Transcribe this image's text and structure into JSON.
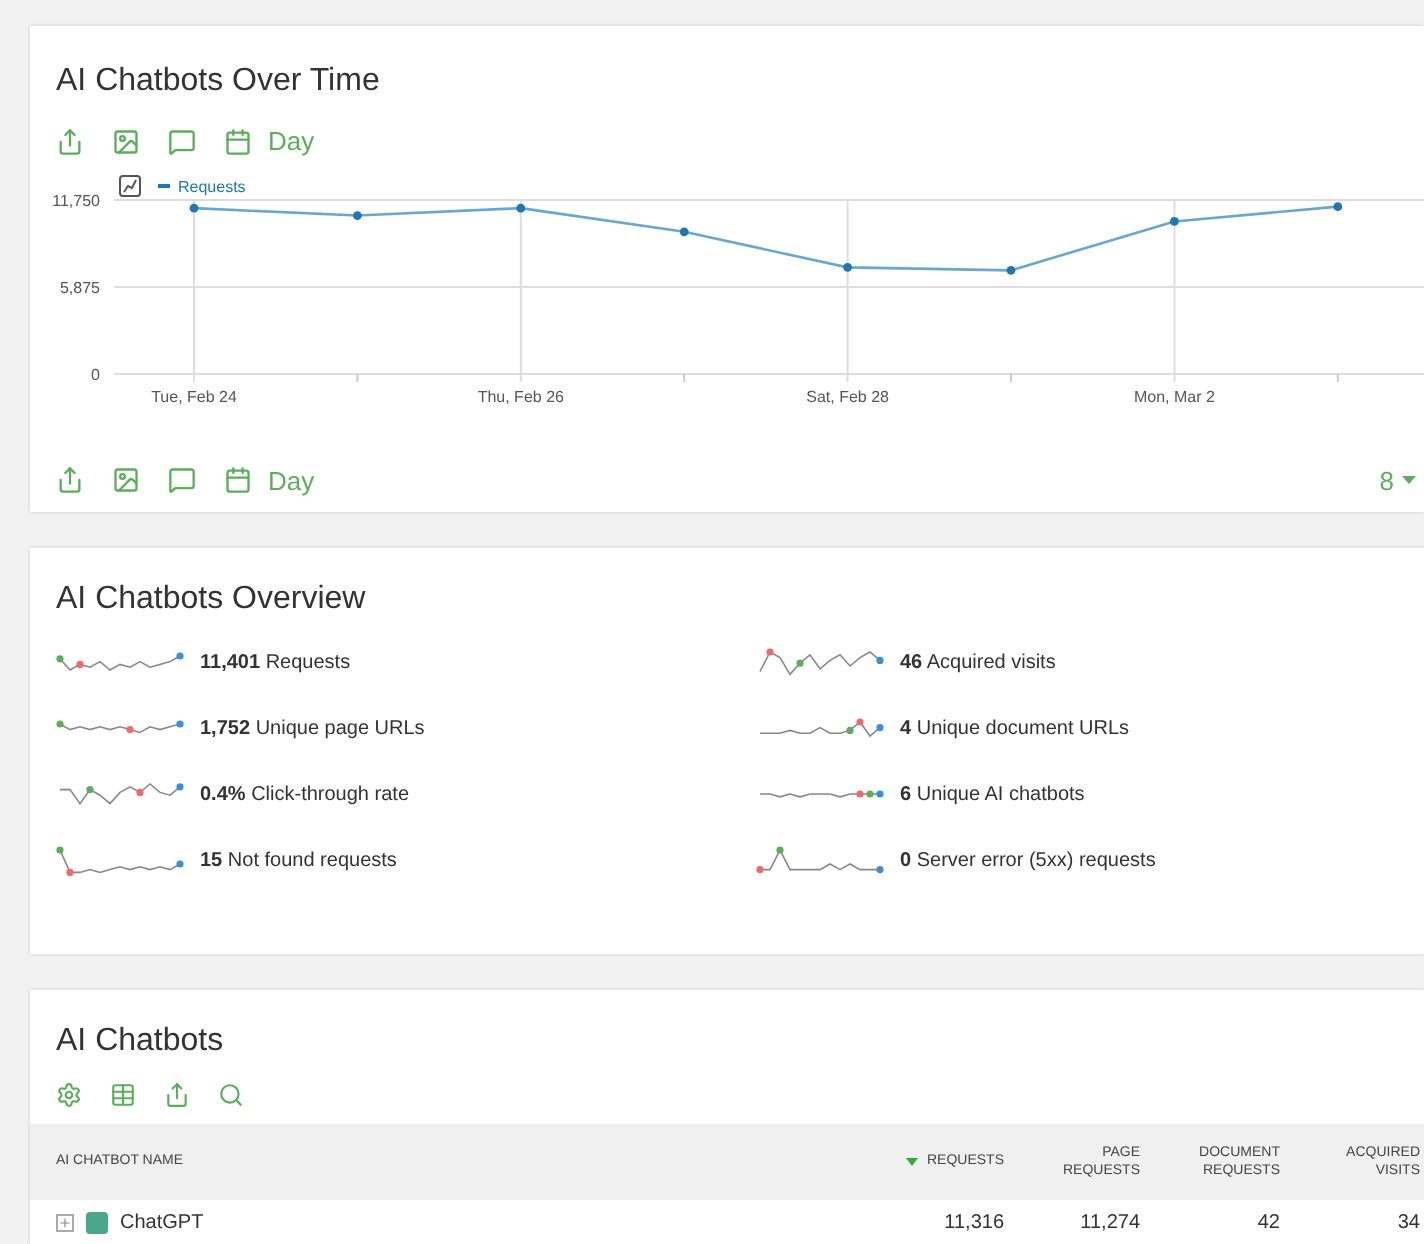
{
  "over_time": {
    "title": "AI Chatbots Over Time",
    "toolbar": {
      "period": "Day"
    },
    "chart_data": {
      "type": "line",
      "categories": [
        "Tue, Feb 24",
        null,
        "Thu, Feb 26",
        null,
        "Sat, Feb 28",
        null,
        "Mon, Mar 2",
        null
      ],
      "yticks": [
        0,
        {
          "value": 5875,
          "label": "5,875"
        },
        {
          "value": 11750,
          "label": "11,750"
        }
      ],
      "ylim": [
        0,
        11750
      ],
      "grid": true,
      "series": [
        {
          "name": "Requests",
          "color": "#1f77b4",
          "marker": true,
          "values": [
            11200,
            10700,
            11200,
            9600,
            7200,
            7000,
            10300,
            11300
          ]
        }
      ]
    },
    "footer": {
      "period": "Day",
      "limit": "8"
    }
  },
  "overview": {
    "title": "AI Chatbots Overview",
    "metrics": [
      {
        "value": "11,401",
        "label": "Requests"
      },
      {
        "value": "46",
        "label": "Acquired visits"
      },
      {
        "value": "1,752",
        "label": "Unique page URLs"
      },
      {
        "value": "4",
        "label": "Unique document URLs"
      },
      {
        "value": "0.4%",
        "label": "Click-through rate"
      },
      {
        "value": "6",
        "label": "Unique AI chatbots"
      },
      {
        "value": "15",
        "label": "Not found requests"
      },
      {
        "value": "0",
        "label": "Server error (5xx) requests"
      }
    ]
  },
  "chatbots": {
    "title": "AI Chatbots",
    "table": {
      "columns": [
        {
          "label": "AI CHATBOT NAME",
          "sorted": false
        },
        {
          "label": "REQUESTS",
          "sorted": true
        },
        {
          "label": "PAGE REQUESTS",
          "sorted": false
        },
        {
          "label": "DOCUMENT REQUESTS",
          "sorted": false
        },
        {
          "label": "ACQUIRED VISITS",
          "sorted": false
        }
      ],
      "rows": [
        {
          "cells": [
            "ChatGPT",
            "11,316",
            "11,274",
            "42",
            "34"
          ]
        }
      ]
    }
  }
}
